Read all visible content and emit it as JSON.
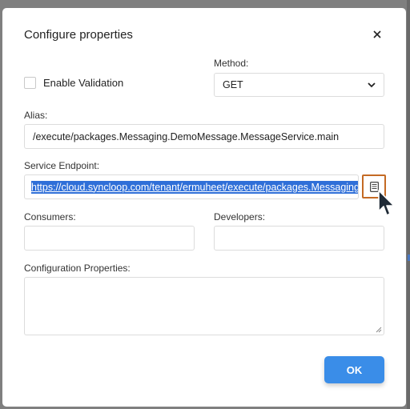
{
  "dialog": {
    "title": "Configure properties"
  },
  "validation": {
    "label": "Enable Validation",
    "checked": false
  },
  "method": {
    "label": "Method:",
    "value": "GET"
  },
  "alias": {
    "label": "Alias:",
    "value": "/execute/packages.Messaging.DemoMessage.MessageService.main"
  },
  "endpoint": {
    "label": "Service Endpoint:",
    "value": "https://cloud.syncloop.com/tenant/ermuheet/execute/packages.Messaging.D"
  },
  "consumers": {
    "label": "Consumers:",
    "value": ""
  },
  "developers": {
    "label": "Developers:",
    "value": ""
  },
  "config": {
    "label": "Configuration Properties:",
    "value": ""
  },
  "ok_button": {
    "label": "OK"
  },
  "colors": {
    "accent": "#3a8de8",
    "selection": "#2f6fd8",
    "highlight_border": "#c46a24"
  },
  "icons": [
    "close-icon",
    "chevron-down-icon",
    "copy-icon",
    "mouse-cursor-icon",
    "resize-handle-icon"
  ]
}
